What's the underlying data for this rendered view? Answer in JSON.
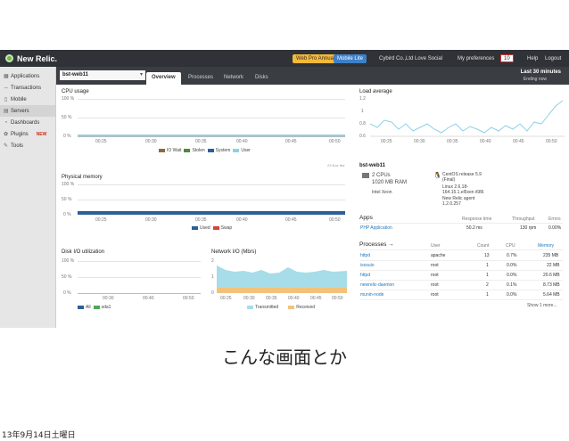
{
  "topbar": {
    "logo": "New Relic.",
    "plan": "Web Pro Annual",
    "mobile": "Mobile Lite",
    "account": "Cybird Co.,Ltd Love Social",
    "preferences": "My preferences",
    "count": "10",
    "help": "Help",
    "logout": "Logout",
    "colors": {
      "bg": "#2f3237",
      "plan": "#f5b83a",
      "mobile": "#3d7fc8"
    }
  },
  "sidebar": {
    "items": [
      {
        "label": "Applications",
        "icon": "grid-icon"
      },
      {
        "label": "Transactions",
        "icon": "arrows-icon"
      },
      {
        "label": "Mobile",
        "icon": "phone-icon"
      },
      {
        "label": "Servers",
        "icon": "server-icon"
      },
      {
        "label": "Dashboards",
        "icon": "dashboard-icon"
      },
      {
        "label": "Plugins",
        "icon": "plugin-icon",
        "badge": "NEW"
      },
      {
        "label": "Tools",
        "icon": "tools-icon"
      }
    ]
  },
  "host": {
    "name": "bst-web11",
    "tabs": [
      "Overview",
      "Processes",
      "Network",
      "Disks"
    ],
    "range_title": "Last 30 minutes",
    "range_sub": "Ending now"
  },
  "cpu": {
    "title": "CPU usage",
    "y_ticks": [
      "100 %",
      "50 %",
      "0 %"
    ],
    "x_ticks": [
      "00:25",
      "00:30",
      "00:35",
      "00:40",
      "00:45",
      "00:50"
    ],
    "legend": [
      {
        "label": "IO Wait",
        "color": "#8b6a3e"
      },
      {
        "label": "Stolen",
        "color": "#4f8a3a"
      },
      {
        "label": "System",
        "color": "#2c5f99"
      },
      {
        "label": "User",
        "color": "#8ed0e6"
      }
    ]
  },
  "memory": {
    "title": "Physical memory",
    "y_ticks": [
      "100 %",
      "50 %",
      "0 %"
    ],
    "x_ticks": [
      "00:25",
      "00:30",
      "00:35",
      "00:40",
      "00:45",
      "00:50"
    ],
    "legend": [
      {
        "label": "Used",
        "color": "#2c5f99"
      },
      {
        "label": "Swap",
        "color": "#d9443a"
      }
    ],
    "badge": "23 Nov fbd"
  },
  "disk": {
    "title": "Disk I/O utilization",
    "y_ticks": [
      "100 %",
      "50 %",
      "0 %"
    ],
    "x_ticks": [
      "00:30",
      "00:40",
      "00:50"
    ],
    "legend": [
      {
        "label": "All",
        "color": "#2c5f99"
      },
      {
        "label": "sda1",
        "color": "#4caa55"
      }
    ]
  },
  "network": {
    "title": "Network I/O (Mb/s)",
    "y_ticks": [
      "2",
      "1",
      "0"
    ],
    "x_ticks": [
      "00:25",
      "00:30",
      "00:35",
      "00:40",
      "00:45",
      "00:50"
    ],
    "legend": [
      {
        "label": "Transmitted",
        "color": "#a6dde8"
      },
      {
        "label": "Received",
        "color": "#f2c27a"
      }
    ]
  },
  "load": {
    "title": "Load average",
    "y_ticks": [
      "1.2",
      "1",
      "0.8",
      "0.6"
    ],
    "x_ticks": [
      "00:25",
      "00:30",
      "00:35",
      "00:40",
      "00:45",
      "00:50"
    ]
  },
  "server_info": {
    "title": "bst-web11",
    "cpus": "2 CPUs",
    "ram": "1020 MB RAM",
    "cpu_model": "Intel Xeon",
    "os": "CentOS release 5.9",
    "os_sub": "(Final)",
    "kernel": "Linux 2.6.18-",
    "kernel2": "164.15.1.el5xen i686",
    "agent": "New Relic agent",
    "agent_ver": "1.2.0.257"
  },
  "apps": {
    "title": "Apps",
    "headers": [
      "Response time",
      "Throughput",
      "Errors"
    ],
    "rows": [
      {
        "name": "PHP Application",
        "response": "50.2 ms",
        "throughput": "130 rpm",
        "errors": "0.00%"
      }
    ]
  },
  "processes": {
    "title": "Processes →",
    "headers": [
      "User",
      "Count",
      "CPU",
      "Memory"
    ],
    "rows": [
      {
        "name": "httpd",
        "user": "apache",
        "count": "13",
        "cpu": "0.7%",
        "memory": "235 MB"
      },
      {
        "name": "isosuio",
        "user": "root",
        "count": "1",
        "cpu": "0.0%",
        "memory": "22 MB"
      },
      {
        "name": "httpd",
        "user": "root",
        "count": "1",
        "cpu": "0.0%",
        "memory": "20.6 MB"
      },
      {
        "name": "newrelic-daemon",
        "user": "root",
        "count": "2",
        "cpu": "0.1%",
        "memory": "8.73 MB"
      },
      {
        "name": "munin-node",
        "user": "root",
        "count": "1",
        "cpu": "0.0%",
        "memory": "5.64 MB"
      }
    ],
    "show_more": "Show 1 more..."
  },
  "caption": "こんな画面とか",
  "footer_date": "13年9月14日土曜日"
}
